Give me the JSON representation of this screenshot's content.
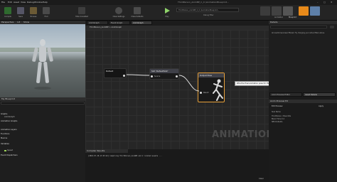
{
  "menu": [
    "File",
    "Edit",
    "Asset",
    "View",
    "Debug",
    "Window",
    "Help"
  ],
  "window": {
    "path": "ThirdPerson_AnimBP_C_0 (AnimationBlueprint...",
    "debug": "Debug Filter"
  },
  "toolbar": {
    "buttons": [
      "Compile",
      "Save",
      "Browse",
      "Find",
      "Hide Unrelated",
      "Class Settings",
      "Class Defaults",
      "Play"
    ],
    "mode_tabs": [
      "Skeleton",
      "Mesh",
      "Animation",
      "Physics",
      "Blueprint"
    ]
  },
  "viewport": {
    "perspective": "Perspective",
    "lit": "Lit",
    "show": "Show"
  },
  "my_blueprint": {
    "title": "My Blueprint",
    "items": [
      "Graphs",
      "AnimGraph",
      "Animation Graphs",
      "Animation Layers",
      "Functions",
      "Macros",
      "Variables",
      "Speed",
      "Event Dispatchers"
    ]
  },
  "graph_tabs": [
    "AnimGraph",
    "Event Graph",
    "AnimGraph"
  ],
  "breadcrumb": [
    "ThirdPerson_AnimBP",
    "AnimGraph"
  ],
  "nodes": {
    "default": "Default",
    "slot": "Slot 'DefaultSlot'",
    "source": "Source",
    "output": "Output Pose",
    "result": "Result"
  },
  "tooltip": "Wire the final animation pose for this graph into this node.",
  "watermark": "ANIMATION",
  "compiler": {
    "title": "Compiler Results",
    "line": "[2018.07.20-13:25:42] Compiling ThirdPerson_AnimBP and 2 related assets ...",
    "clear": "Clear"
  },
  "details": {
    "title": "Details",
    "search_placeholder": "Search",
    "no_results": "All results have been filtered. Try changing your active filters above.",
    "preview_tabs": [
      "Anim Preview Editor",
      "Asset Details"
    ]
  },
  "preview": {
    "header": "Anim Preview Ed",
    "rows": [
      "Edit Preview",
      "Skel Name",
      "ThirdPerson / BasicIdle",
      "Blend Time 0.2",
      "SBS Defaults"
    ],
    "apply": "Apply"
  },
  "colors": {
    "accent": "#e88a1a",
    "node_title": "#1a1a1a",
    "slot_title": "#3f4048",
    "output_border": "#e8a13a"
  }
}
